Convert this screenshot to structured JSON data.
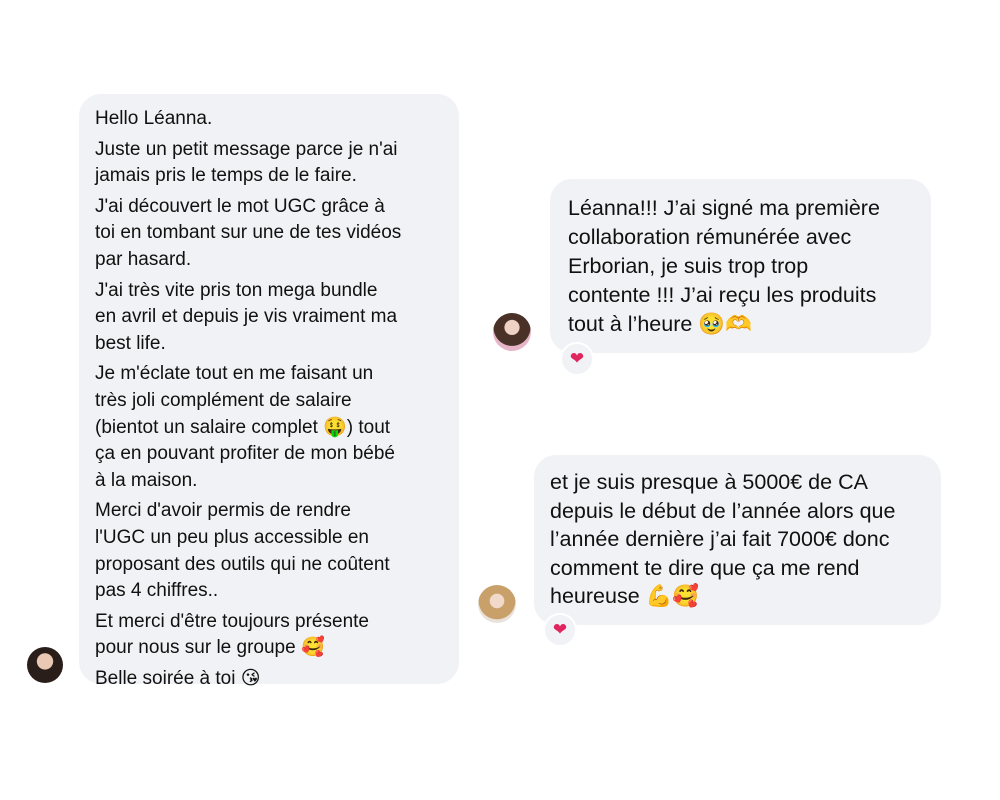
{
  "messages": [
    {
      "id": "msg-1",
      "lines": [
        [
          "Hello Léanna."
        ],
        [
          "Juste un petit message parce je n'ai",
          "jamais pris le temps de le faire."
        ],
        [
          "J'ai découvert le mot UGC grâce à",
          "toi en tombant sur une de tes vidéos",
          "par hasard."
        ],
        [
          "J'ai très vite pris ton mega bundle",
          "en avril et depuis je vis vraiment ma",
          "best life."
        ],
        [
          "Je m'éclate tout en me faisant un",
          "très joli complément de salaire",
          "(bientot un salaire complet 🤑) tout",
          "ça en pouvant profiter de mon bébé",
          "à la maison."
        ],
        [
          "Merci d'avoir permis de rendre",
          "l'UGC un peu plus accessible en",
          "proposant des outils qui ne coûtent",
          "pas 4 chiffres.."
        ],
        [
          "Et merci d'être toujours présente",
          "pour nous sur le groupe 🥰"
        ],
        [
          "Belle soirée à toi 😘"
        ]
      ],
      "avatar_icon": "avatar-brunette-icon"
    },
    {
      "id": "msg-2",
      "lines": [
        "Léanna!!! J’ai signé ma première",
        "collaboration rémunérée avec",
        "Erborian, je suis trop trop",
        "contente !!! J’ai reçu les produits",
        "tout à l’heure 🥹🫶"
      ],
      "reaction": "❤",
      "avatar_icon": "avatar-pink-top-icon"
    },
    {
      "id": "msg-3",
      "lines": [
        "et je suis presque à 5000€ de CA",
        "depuis le début de l’année alors que",
        "l’année dernière j’ai fait 7000€ donc",
        "comment te dire que ça me rend",
        "heureuse 💪🥰"
      ],
      "reaction": "❤",
      "avatar_icon": "avatar-blonde-icon"
    }
  ],
  "colors": {
    "bubble": "#f1f2f5",
    "text": "#111111",
    "heart": "#e0245e",
    "background": "#ffffff"
  }
}
